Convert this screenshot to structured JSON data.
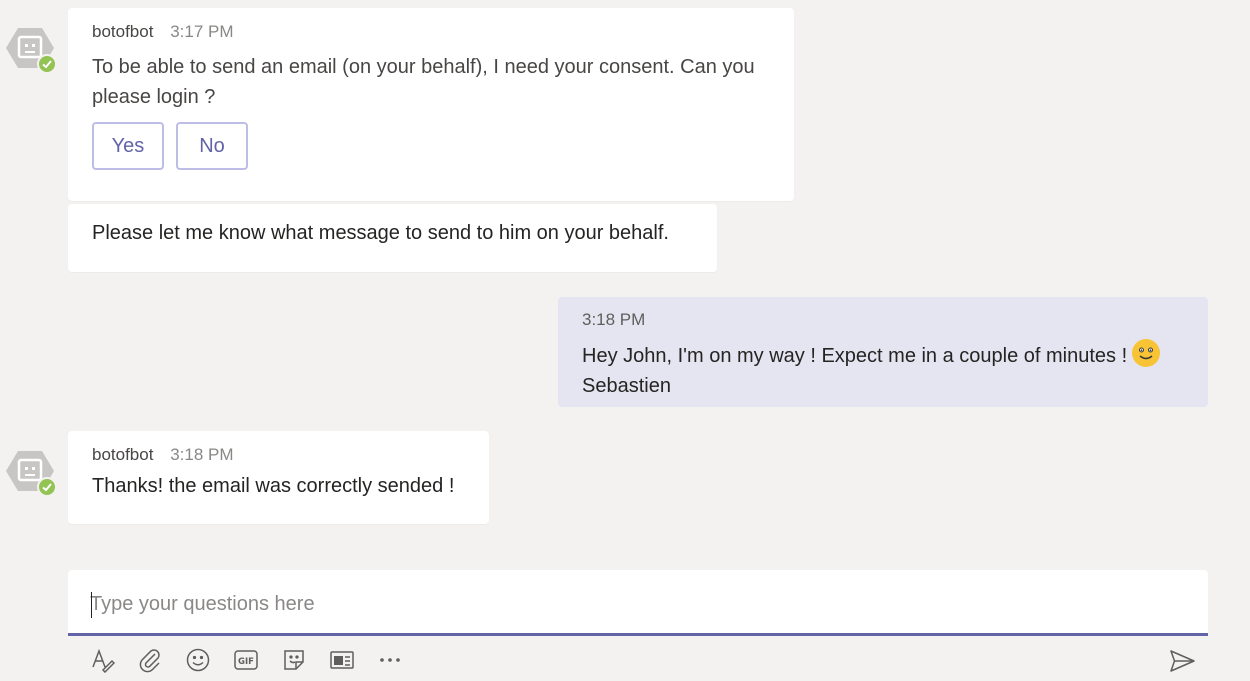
{
  "messages": {
    "m1": {
      "sender": "botofbot",
      "time": "3:17 PM",
      "text": "To be able to send an email (on your behalf), I need your consent. Can you please login ?",
      "buttons": {
        "yes": "Yes",
        "no": "No"
      }
    },
    "m2": {
      "text": "Please let me know what message to send to him on your behalf."
    },
    "m3": {
      "time": "3:18 PM",
      "line1": "Hey John, I'm on my way ! Expect me in a couple of minutes !",
      "emoji": "smiley-emoji",
      "line2": "Sebastien"
    },
    "m4": {
      "sender": "botofbot",
      "time": "3:18 PM",
      "text": "Thanks! the email was correctly sended !"
    }
  },
  "compose": {
    "placeholder": "Type your questions here"
  },
  "toolbar": {
    "icons": [
      "format-icon",
      "attach-icon",
      "emoji-icon",
      "gif-icon",
      "sticker-icon",
      "meet-icon",
      "more-icon"
    ],
    "send_icon": "send-icon"
  },
  "colors": {
    "accent": "#6264a7",
    "self_bubble": "#e5e5f1",
    "presence": "#92c353"
  }
}
